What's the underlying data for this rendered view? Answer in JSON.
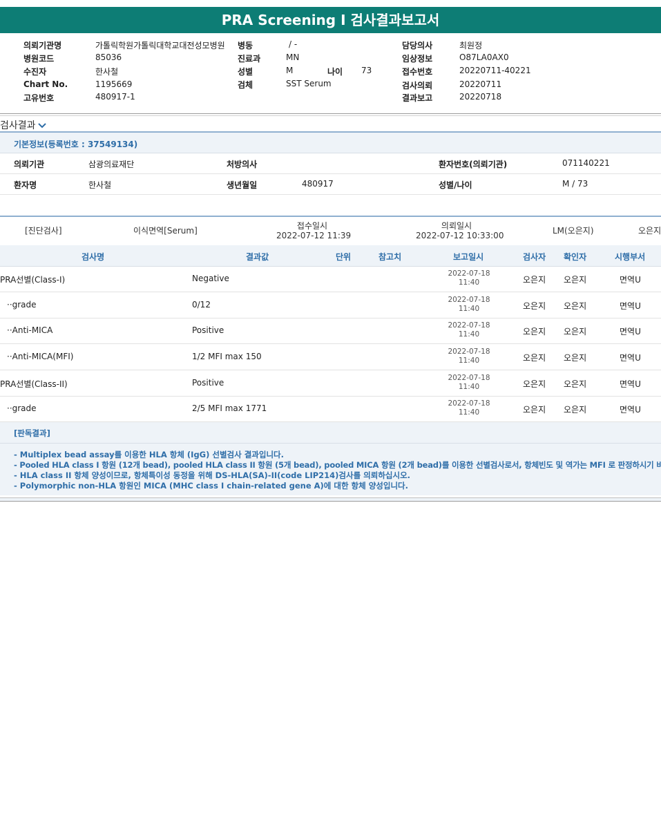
{
  "title": "PRA Screening I 검사결과보고서",
  "header": {
    "labels": {
      "institution": "의뢰기관명",
      "hospital_code": "병원코드",
      "patient": "수진자",
      "chart_no": "Chart No.",
      "unique_no": "고유번호",
      "ward": "병동",
      "dept": "진료과",
      "sex": "성별",
      "age": "나이",
      "specimen": "검체",
      "doctor": "담당의사",
      "clinical_info": "임상정보",
      "receipt_no": "접수번호",
      "req_date": "검사의뢰",
      "report_date": "결과보고"
    },
    "values": {
      "institution": "가톨릭학원가톨릭대학교대전성모병원",
      "hospital_code": "85036",
      "patient": "한사철",
      "chart_no": "1195669",
      "unique_no": "480917-1",
      "ward": "/ -",
      "dept": "MN",
      "sex": "M",
      "age": "73",
      "specimen": "SST Serum",
      "doctor": "최원정",
      "clinical_info": "O87LA0AX0",
      "receipt_no": "20220711-40221",
      "req_date": "20220711",
      "report_date": "20220718"
    }
  },
  "results_section": {
    "title": "검사결과",
    "basic_info_title": "기본정보(등록번호 : 37549134)",
    "labels": {
      "institution": "의뢰기관",
      "doctor": "처방의사",
      "patient_no": "환자번호(의뢰기관)",
      "patient_name": "환자명",
      "birth": "생년월일",
      "sex_age": "성별/나이"
    },
    "values": {
      "institution": "삼광의료재단",
      "doctor": "",
      "patient_no": "071140221",
      "patient_name": "한사철",
      "birth": "480917",
      "sex_age": "M / 73"
    }
  },
  "diagnosis": {
    "category": "[진단검사]",
    "test": "이식면역[Serum]",
    "received_label": "접수일시",
    "received": "2022-07-12  11:39",
    "requested_label": "의뢰일시",
    "requested": "2022-07-12  10:33:00",
    "examiner_code": "LM(오은지)",
    "examiner": "오은지"
  },
  "table": {
    "headers": [
      "검사명",
      "결과값",
      "단위",
      "참고치",
      "보고일시",
      "검사자",
      "확인자",
      "시행부서"
    ],
    "rows": [
      {
        "name": "PRA선별(Class-I)",
        "result": "Negative",
        "unit": "",
        "ref": "",
        "date": "2022-07-18",
        "time": "11:40",
        "tester": "오은지",
        "confirmer": "오은지",
        "dept": "면역U"
      },
      {
        "name": "  ··grade",
        "result": "0/12",
        "unit": "",
        "ref": "",
        "date": "2022-07-18",
        "time": "11:40",
        "tester": "오은지",
        "confirmer": "오은지",
        "dept": "면역U"
      },
      {
        "name": "  ··Anti-MICA",
        "result": "Positive",
        "unit": "",
        "ref": "",
        "date": "2022-07-18",
        "time": "11:40",
        "tester": "오은지",
        "confirmer": "오은지",
        "dept": "면역U"
      },
      {
        "name": "  ··Anti-MICA(MFI)",
        "result": "1/2 MFI max 150",
        "unit": "",
        "ref": "",
        "date": "2022-07-18",
        "time": "11:40",
        "tester": "오은지",
        "confirmer": "오은지",
        "dept": "면역U"
      },
      {
        "name": "PRA선별(Class-II)",
        "result": "Positive",
        "unit": "",
        "ref": "",
        "date": "2022-07-18",
        "time": "11:40",
        "tester": "오은지",
        "confirmer": "오은지",
        "dept": "면역U"
      },
      {
        "name": "  ··grade",
        "result": "2/5 MFI max 1771",
        "unit": "",
        "ref": "",
        "date": "2022-07-18",
        "time": "11:40",
        "tester": "오은지",
        "confirmer": "오은지",
        "dept": "면역U"
      }
    ]
  },
  "interpretation": {
    "title": "[판독결과]",
    "lines": [
      "- Multiplex bead assay를 이용한 HLA 항체 (IgG) 선별검사 결과입니다.",
      "- Pooled HLA class I 항원 (12개 bead), pooled HLA class II 항원 (5개 bead), pooled MICA 항원 (2개 bead)를 이용한 선별검사로서, 항체빈도 및 역가는 MFI 로 판정하시기 바랍니다.",
      "- HLA class II 항체 양성이므로, 항체특이성 동정을 위해 DS-HLA(SA)-II(code LIP214)검사를 의뢰하십시오.",
      "- Polymorphic non-HLA 항원인 MICA (MHC class I chain-related gene A)에 대한 항체 양성입니다."
    ]
  },
  "colors": {
    "title_bg": "#0d7d75",
    "accent_blue": "#2f6ea8",
    "header_bg": "#eef3f8"
  }
}
